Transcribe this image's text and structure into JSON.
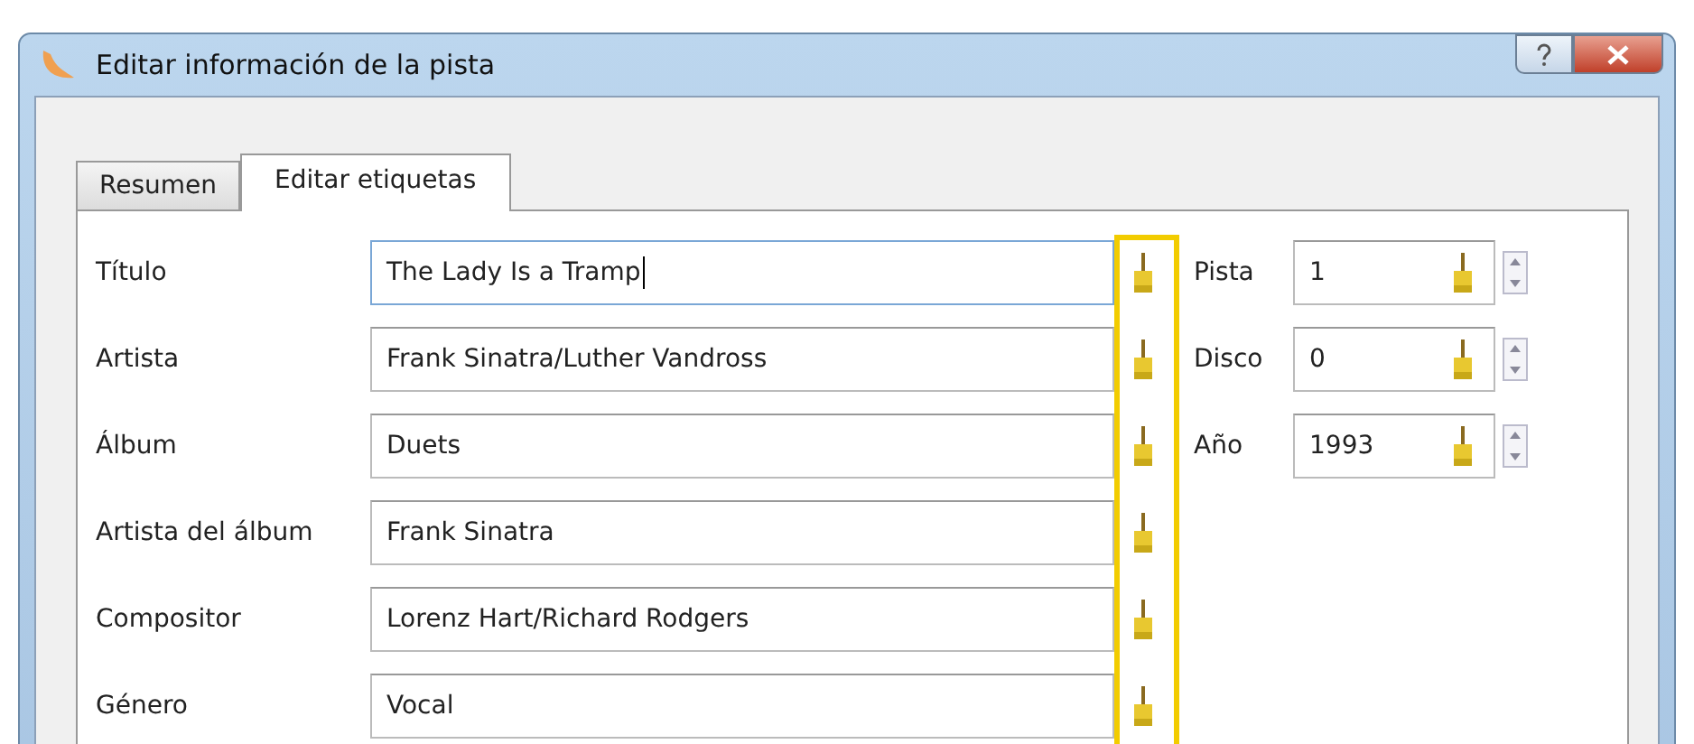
{
  "window": {
    "title": "Editar información de la pista"
  },
  "tabs": [
    {
      "label": "Resumen",
      "selected": false
    },
    {
      "label": "Editar etiquetas",
      "selected": true
    }
  ],
  "fields": [
    {
      "label": "Título",
      "value": "The Lady Is a Tramp",
      "focused": true
    },
    {
      "label": "Artista",
      "value": "Frank Sinatra/Luther Vandross",
      "focused": false
    },
    {
      "label": "Álbum",
      "value": "Duets",
      "focused": false
    },
    {
      "label": "Artista del álbum",
      "value": "Frank Sinatra",
      "focused": false
    },
    {
      "label": "Compositor",
      "value": "Lorenz Hart/Richard Rodgers",
      "focused": false
    },
    {
      "label": "Género",
      "value": "Vocal",
      "focused": false
    }
  ],
  "number_fields": [
    {
      "label": "Pista",
      "value": "1"
    },
    {
      "label": "Disco",
      "value": "0"
    },
    {
      "label": "Año",
      "value": "1993"
    }
  ]
}
